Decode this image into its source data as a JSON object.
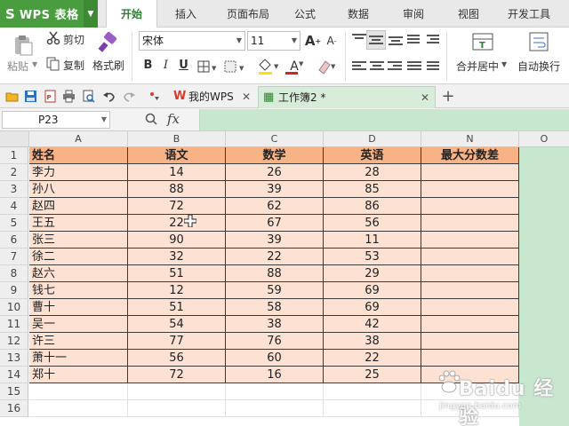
{
  "app": {
    "logo": "S",
    "name": "WPS 表格"
  },
  "menu": [
    "开始",
    "插入",
    "页面布局",
    "公式",
    "数据",
    "审阅",
    "视图",
    "开发工具"
  ],
  "ribbon": {
    "paste": "粘贴",
    "cut": "剪切",
    "copy": "复制",
    "format_painter": "格式刷",
    "font_name": "宋体",
    "font_size": "11",
    "grow_font": "A",
    "shrink_font": "A",
    "bold": "B",
    "italic": "I",
    "underline": "U",
    "font_color_letter": "A",
    "merge_center": "合并居中",
    "wrap_text": "自动换行"
  },
  "doc_tabs": [
    {
      "label": "我的WPS",
      "active": false
    },
    {
      "label": "工作簿2 *",
      "active": true
    }
  ],
  "formula_bar": {
    "cell_ref": "P23",
    "fx": "fx",
    "formula": ""
  },
  "sheet": {
    "columns": [
      "A",
      "B",
      "C",
      "D",
      "N",
      "O"
    ],
    "rows": [
      "1",
      "2",
      "3",
      "4",
      "5",
      "6",
      "7",
      "8",
      "9",
      "10",
      "11",
      "12",
      "13",
      "14",
      "15",
      "16"
    ],
    "header": [
      "姓名",
      "语文",
      "数学",
      "英语",
      "最大分数差"
    ],
    "data": [
      [
        "李力",
        "14",
        "26",
        "28",
        ""
      ],
      [
        "孙八",
        "88",
        "39",
        "85",
        ""
      ],
      [
        "赵四",
        "72",
        "62",
        "86",
        ""
      ],
      [
        "王五",
        "22",
        "67",
        "56",
        ""
      ],
      [
        "张三",
        "90",
        "39",
        "11",
        ""
      ],
      [
        "徐二",
        "32",
        "22",
        "53",
        ""
      ],
      [
        "赵六",
        "51",
        "88",
        "29",
        ""
      ],
      [
        "钱七",
        "12",
        "59",
        "69",
        ""
      ],
      [
        "曹十",
        "51",
        "58",
        "69",
        ""
      ],
      [
        "吴一",
        "54",
        "38",
        "42",
        ""
      ],
      [
        "许三",
        "77",
        "76",
        "38",
        ""
      ],
      [
        "萧十一",
        "56",
        "60",
        "22",
        ""
      ],
      [
        "郑十",
        "72",
        "16",
        "25",
        ""
      ]
    ]
  },
  "colors": {
    "app_green": "#4a9d3f",
    "header_fill": "#f7b286",
    "body_fill": "#fde2d3",
    "selection_green": "#c8e7cf"
  },
  "watermark": {
    "text": "Baidu 经验",
    "url": "jingyan.baidu.com"
  }
}
